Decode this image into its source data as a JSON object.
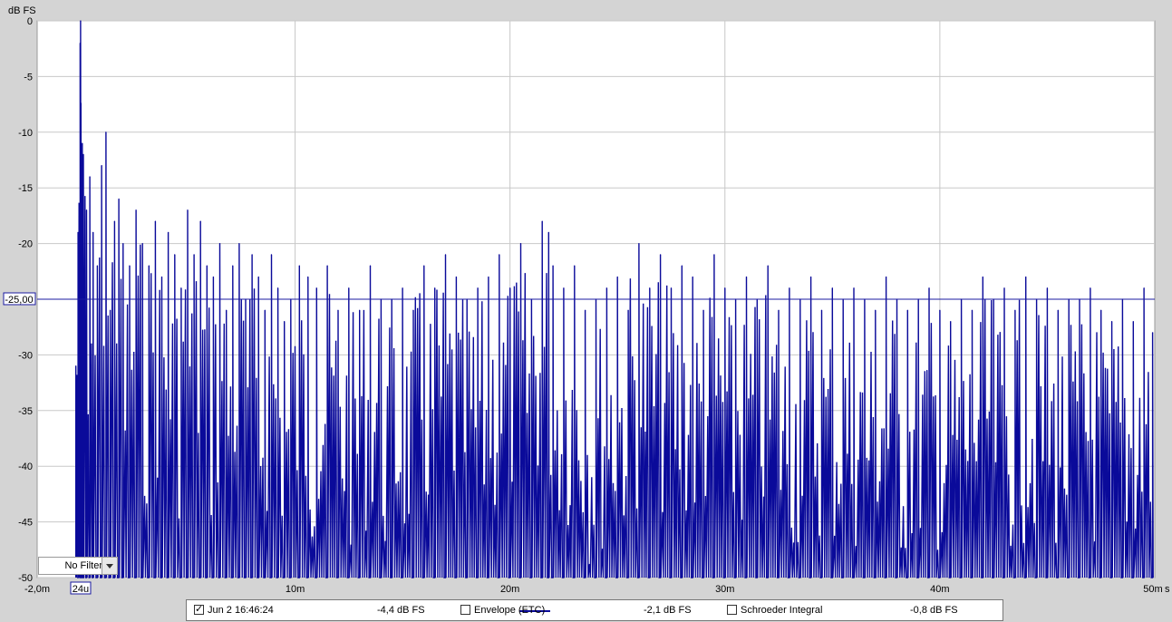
{
  "chart_data": {
    "type": "line",
    "ylabel": "dB FS",
    "x_unit_label": "s",
    "xlim": [
      -2.0,
      50.0
    ],
    "ylim": [
      -50,
      0
    ],
    "grid": true,
    "x_ticks": [
      {
        "value": -2.0,
        "label": "-2,0m"
      },
      {
        "value": 10,
        "label": "10m"
      },
      {
        "value": 20,
        "label": "20m"
      },
      {
        "value": 30,
        "label": "30m"
      },
      {
        "value": 40,
        "label": "40m"
      },
      {
        "value": 50,
        "label": "50m"
      }
    ],
    "y_ticks": [
      {
        "value": 0,
        "label": "0"
      },
      {
        "value": -5,
        "label": "-5"
      },
      {
        "value": -10,
        "label": "-10"
      },
      {
        "value": -15,
        "label": "-15"
      },
      {
        "value": -20,
        "label": "-20"
      },
      {
        "value": -25,
        "label": "-25"
      },
      {
        "value": -30,
        "label": "-30"
      },
      {
        "value": -35,
        "label": "-35"
      },
      {
        "value": -40,
        "label": "-40"
      },
      {
        "value": -45,
        "label": "-45"
      },
      {
        "value": -50,
        "label": "-50"
      }
    ],
    "cursor": {
      "x": 0.024,
      "x_label": "24u",
      "y": -25.0,
      "y_label": "-25,00"
    },
    "series_color": "#0a0a9a",
    "series": [
      {
        "name": "Jun 2 16:46:24",
        "x": [
          -0.2,
          -0.1,
          0.0,
          0.02,
          0.05,
          0.1,
          0.15,
          0.3,
          0.45,
          0.6,
          0.8,
          1.0,
          1.2,
          1.4,
          1.6,
          1.8,
          2.0,
          2.3,
          2.6,
          2.9,
          3.2,
          3.5,
          3.8,
          4.1,
          4.4,
          4.7,
          5.0,
          5.3,
          5.6,
          5.9,
          6.2,
          6.5,
          6.8,
          7.1,
          7.4,
          7.7,
          8.0,
          8.3,
          8.6,
          8.9,
          9.2,
          9.5,
          9.8,
          10.2,
          10.6,
          11.0,
          11.5,
          12.0,
          12.5,
          13.0,
          13.5,
          14.0,
          14.5,
          15.0,
          15.5,
          16.0,
          16.5,
          17.0,
          17.5,
          18.0,
          18.5,
          19.0,
          19.5,
          20.0,
          20.5,
          21.0,
          21.5,
          21.8,
          22.0,
          22.5,
          23.0,
          23.5,
          24.0,
          24.5,
          25.0,
          25.5,
          26.0,
          26.5,
          27.0,
          27.5,
          28.0,
          28.5,
          29.0,
          29.5,
          30.0,
          30.5,
          31.0,
          31.5,
          32.0,
          32.5,
          33.0,
          33.5,
          34.0,
          34.5,
          35.0,
          35.5,
          36.0,
          36.5,
          37.0,
          37.5,
          38.0,
          38.5,
          39.0,
          39.5,
          40.0,
          40.5,
          41.0,
          41.5,
          42.0,
          42.5,
          43.0,
          43.5,
          44.0,
          44.5,
          45.0,
          45.5,
          46.0,
          46.5,
          47.0,
          47.5,
          48.0,
          48.5,
          49.0,
          49.5,
          49.9
        ],
        "peaks": [
          -31,
          -19,
          -2,
          0,
          -13,
          -11,
          -12,
          -17,
          -14,
          -19,
          -22,
          -13,
          -10,
          -26,
          -18,
          -16,
          -20,
          -22,
          -17,
          -20,
          -22,
          -18,
          -23,
          -19,
          -21,
          -24,
          -17,
          -21,
          -18,
          -22,
          -23,
          -20,
          -26,
          -22,
          -20,
          -25,
          -21,
          -23,
          -26,
          -21,
          -24,
          -27,
          -25,
          -22,
          -23,
          -24,
          -22,
          -26,
          -24,
          -26,
          -22,
          -25,
          -25,
          -24,
          -26,
          -22,
          -24,
          -21,
          -23,
          -25,
          -24,
          -23,
          -21,
          -24,
          -20,
          -25,
          -18,
          -19,
          -22,
          -24,
          -22,
          -26,
          -25,
          -24,
          -23,
          -26,
          -20,
          -24,
          -21,
          -24,
          -22,
          -23,
          -26,
          -21,
          -24,
          -25,
          -23,
          -25,
          -22,
          -26,
          -24,
          -25,
          -23,
          -26,
          -24,
          -25,
          -24,
          -25,
          -26,
          -23,
          -25,
          -26,
          -25,
          -24,
          -26,
          -27,
          -25,
          -26,
          -23,
          -25,
          -24,
          -26,
          -23,
          -25,
          -24,
          -26,
          -25,
          -25,
          -24,
          -26,
          -27,
          -25,
          -27,
          -24,
          -28
        ],
        "legend_value": "-4,4 dB FS",
        "checked": true
      }
    ],
    "noise_floor": -50
  },
  "filter": {
    "label": "No Filter"
  },
  "legend": {
    "series_label": "Jun 2 16:46:24",
    "series_value": "-4,4 dB FS",
    "envelope_label": "Envelope (ETC)",
    "envelope_value": "-2,1 dB FS",
    "schroeder_label": "Schroeder Integral",
    "schroeder_value": "-0,8 dB FS",
    "check_mark": "✓"
  }
}
